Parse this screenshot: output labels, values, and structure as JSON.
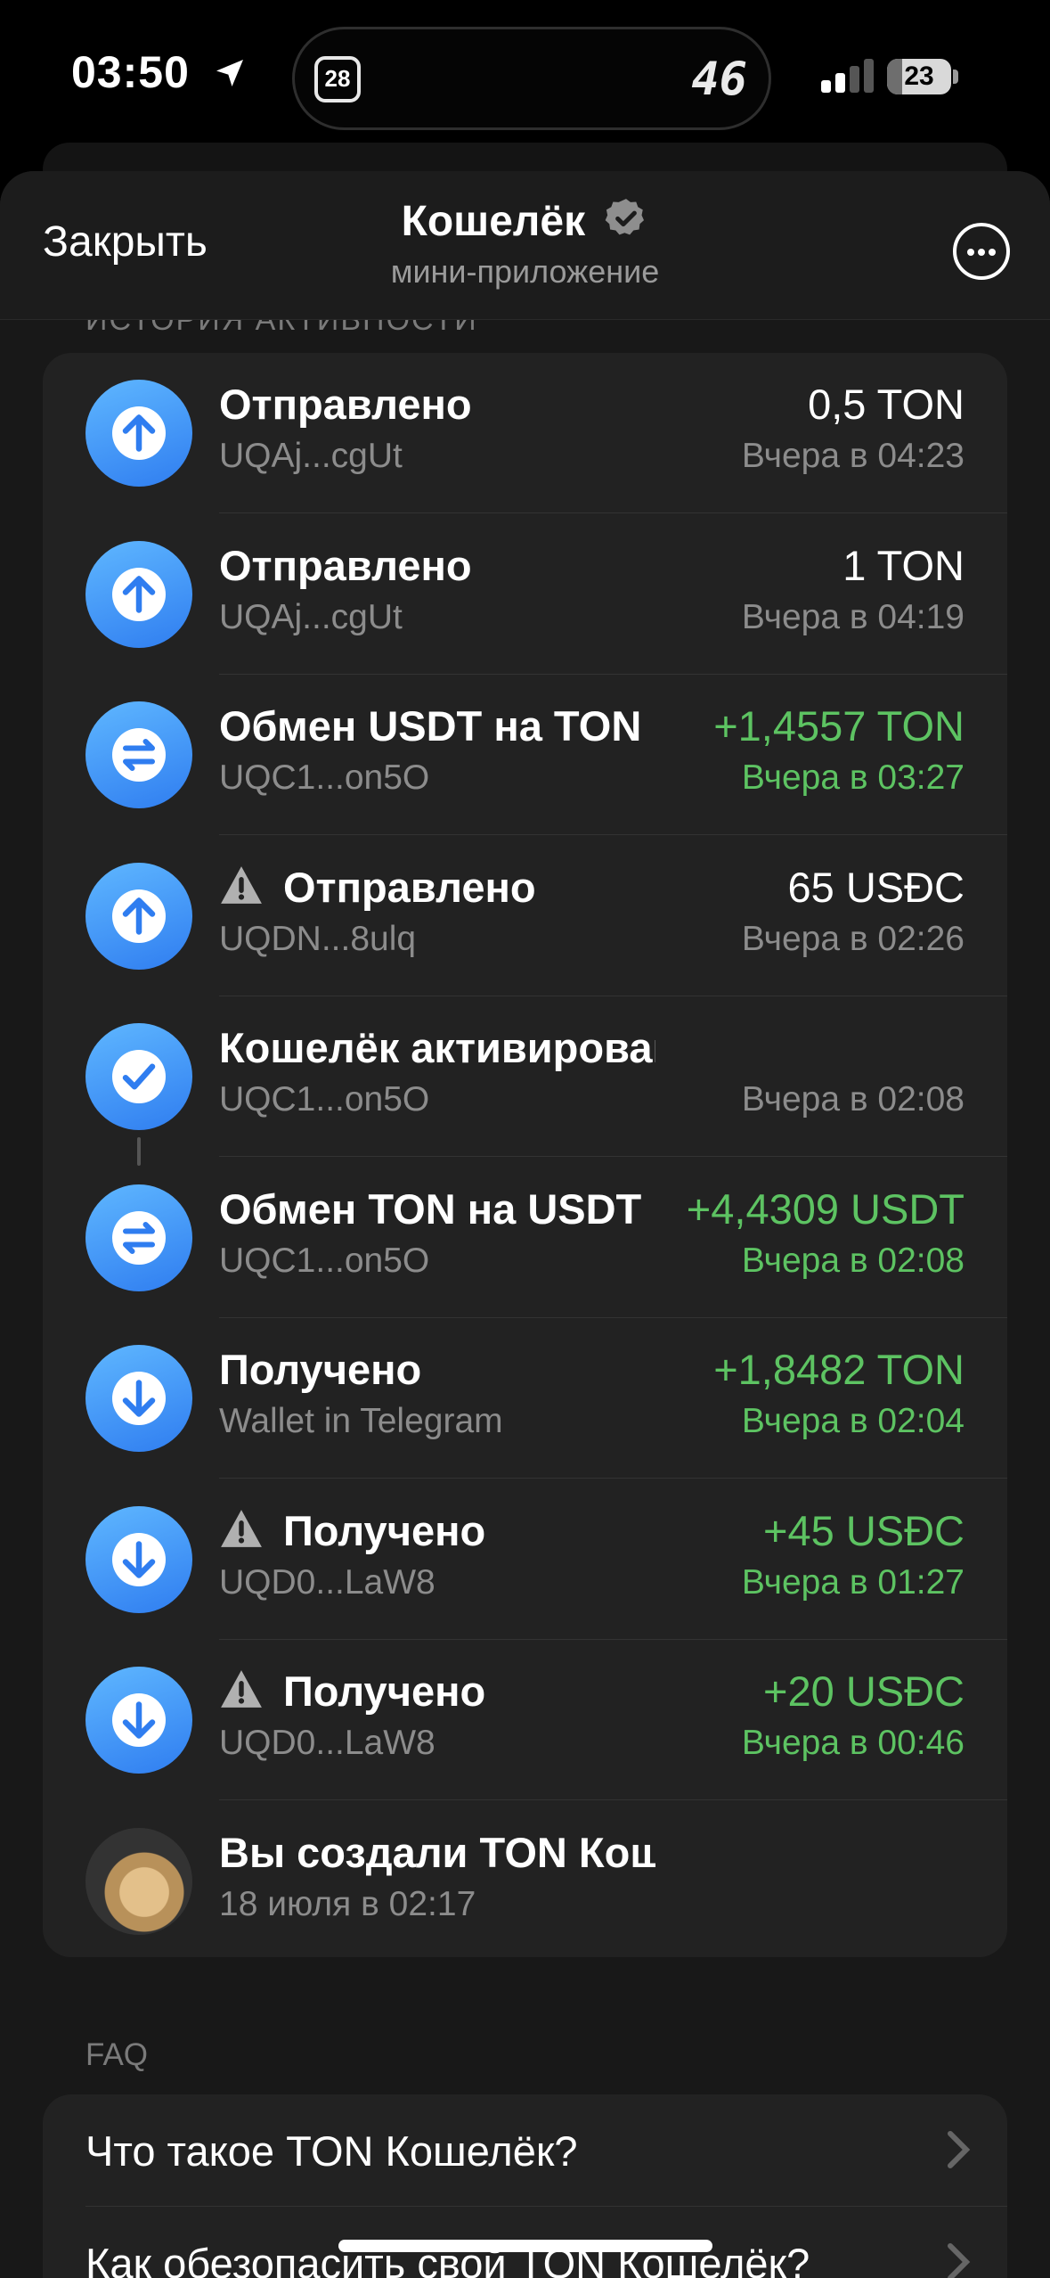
{
  "status": {
    "time": "03:50",
    "calendar_day": "28",
    "island_number": "46",
    "battery": "23",
    "battery_level_percent": 23
  },
  "header": {
    "close_label": "Закрыть",
    "title": "Кошелёк",
    "subtitle": "мини-приложение"
  },
  "section_peek": "ИСТОРИЯ АКТИВНОСТИ",
  "transactions": [
    {
      "type": "sent",
      "warning": false,
      "title": "Отправлено",
      "address": "UQAj...cgUt",
      "amount": "0,5 TON",
      "date": "Вчера в 04:23",
      "positive": false
    },
    {
      "type": "sent",
      "warning": false,
      "title": "Отправлено",
      "address": "UQAj...cgUt",
      "amount": "1 TON",
      "date": "Вчера в 04:19",
      "positive": false
    },
    {
      "type": "swap",
      "warning": false,
      "title": "Обмен USDT на TON",
      "address": "UQC1...on5O",
      "amount": "+1,4557 TON",
      "date": "Вчера в 03:27",
      "positive": true
    },
    {
      "type": "sent",
      "warning": true,
      "title": "Отправлено",
      "address": "UQDN...8ulq",
      "amount": "65 USĐC",
      "date": "Вчера в 02:26",
      "positive": false
    },
    {
      "type": "activated",
      "warning": false,
      "title": "Кошелёк активирован",
      "address": "UQC1...on5O",
      "amount": "",
      "date": "Вчера в 02:08",
      "positive": false
    },
    {
      "type": "swap",
      "warning": false,
      "title": "Обмен TON на USDT",
      "address": "UQC1...on5O",
      "amount": "+4,4309 USDT",
      "date": "Вчера в 02:08",
      "positive": true
    },
    {
      "type": "received",
      "warning": false,
      "title": "Получено",
      "address": "Wallet in Telegram",
      "amount": "+1,8482 TON",
      "date": "Вчера в 02:04",
      "positive": true
    },
    {
      "type": "received",
      "warning": true,
      "title": "Получено",
      "address": "UQD0...LaW8",
      "amount": "+45 USĐC",
      "date": "Вчера в 01:27",
      "positive": true
    },
    {
      "type": "received",
      "warning": true,
      "title": "Получено",
      "address": "UQD0...LaW8",
      "amount": "+20 USĐC",
      "date": "Вчера в 00:46",
      "positive": true
    },
    {
      "type": "created",
      "warning": false,
      "title": "Вы создали TON Кошелёк",
      "address": "18 июля в 02:17",
      "amount": "",
      "date": "",
      "positive": false
    }
  ],
  "faq": {
    "label": "FAQ",
    "items": [
      "Что такое TON Кошелёк?",
      "Как обезопасить свой TON Кошелёк?"
    ]
  },
  "colors": {
    "positive": "#5dc362",
    "icon_gradient_top": "#5fb7ff",
    "icon_gradient_bottom": "#2f7df0"
  }
}
